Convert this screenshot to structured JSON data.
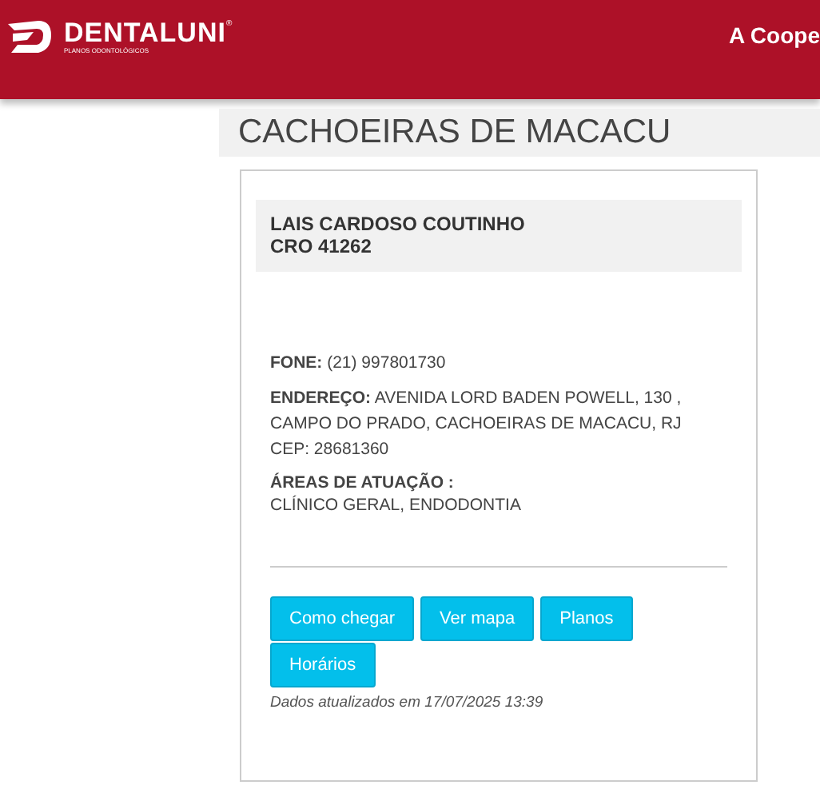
{
  "header": {
    "brand": "DENTALUNI",
    "brand_mark": "®",
    "tagline": "PLANOS ODONTOLÓGICOS",
    "nav_text": "A Coope"
  },
  "city_title": "CACHOEIRAS DE MACACU",
  "dentist": {
    "name": "LAIS CARDOSO COUTINHO",
    "cro": "CRO 41262"
  },
  "phone": "**FONE:** (21) 997801730",
  "address": [
    "**ENDEREÇO:** AVENIDA LORD BADEN POWELL, 130 ,",
    "CAMPO DO PRADO, CACHOEIRAS DE MACACU, RJ",
    "CEP: 28681360"
  ],
  "areas": {
    "label": "ÁREAS DE ATUAÇÃO :",
    "value": "CLÍNICO GERAL, ENDODONTIA"
  },
  "buttons": [
    "Como chegar",
    "Ver mapa",
    "Planos",
    "Horários"
  ],
  "updated": "Dados atualizados em 17/07/2025 13:39"
}
